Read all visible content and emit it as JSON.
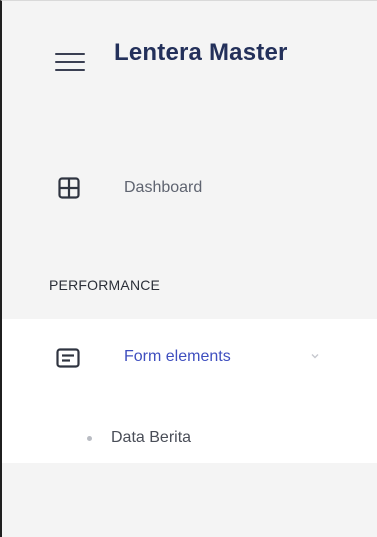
{
  "header": {
    "brand": "Lentera Master",
    "menu_icon": "hamburger-menu-icon"
  },
  "nav": {
    "dashboard": {
      "label": "Dashboard",
      "icon": "grid-icon"
    },
    "section": "PERFORMANCE",
    "form_elements": {
      "label": "Form elements",
      "icon": "form-icon",
      "expanded": true,
      "chevron_icon": "chevron-down-icon",
      "children": [
        {
          "label": "Data Berita"
        }
      ]
    }
  },
  "colors": {
    "brand": "#23305a",
    "active_label": "#3f4fbf",
    "sidebar_bg": "#f4f4f4",
    "active_bg": "#ffffff"
  }
}
